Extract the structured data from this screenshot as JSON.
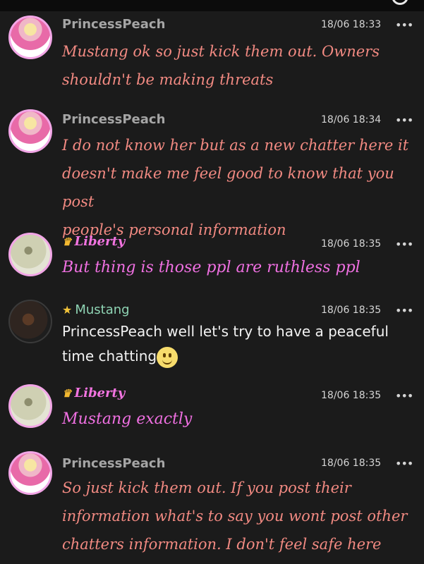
{
  "messages": [
    {
      "user": "PrincessPeach",
      "time": "18/06 18:33",
      "more": "•••",
      "lines": [
        "Mustang ok so just kick them out. Owners",
        "shouldn't be making threats"
      ]
    },
    {
      "user": "PrincessPeach",
      "time": "18/06 18:34",
      "more": "•••",
      "lines": [
        "I do not know her but as a new chatter here it",
        "doesn't make me feel good to know that you post",
        "people's personal information"
      ]
    },
    {
      "user": "Liberty",
      "time": "18/06 18:35",
      "more": "•••",
      "lines": [
        "But thing is those ppl are ruthless ppl"
      ]
    },
    {
      "user": "Mustang",
      "time": "18/06 18:35",
      "more": "•••",
      "lines": [
        "PrincessPeach well let's try to have a peaceful",
        "time chatting"
      ]
    },
    {
      "user": "Liberty",
      "time": "18/06 18:35",
      "more": "•••",
      "lines": [
        "Mustang exactly"
      ]
    },
    {
      "user": "PrincessPeach",
      "time": "18/06 18:35",
      "more": "•••",
      "lines": [
        "So just kick them out. If you post their",
        "information what's to say you wont post other",
        "chatters information. I don't feel safe here"
      ]
    }
  ],
  "icons": {
    "owner_badge": "crown-icon",
    "mod_badge": "star-icon",
    "options": "more-options-icon",
    "emoji": "smiley-emoji"
  }
}
